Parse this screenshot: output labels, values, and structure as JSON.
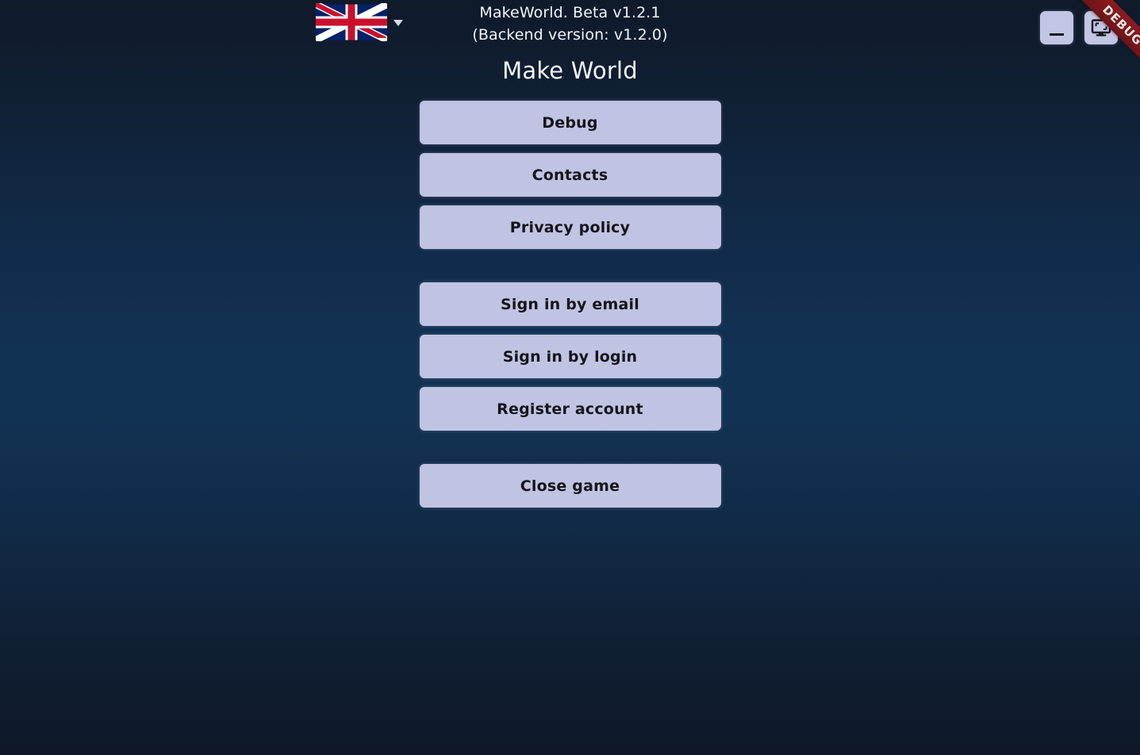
{
  "window": {
    "title_line1": "MakeWorld. Beta v1.2.1",
    "title_line2": "(Backend version: v1.2.0)",
    "debug_ribbon_label": "DEBUG",
    "minimize_label": "Minimize",
    "fullscreen_label": "Toggle fullscreen",
    "minimize_icon": "minimize-icon",
    "fullscreen_icon": "monitor-icon"
  },
  "language": {
    "selected": "English (United Kingdom)",
    "flag_icon": "union-jack-flag-icon",
    "caret_icon": "chevron-down-icon"
  },
  "menu": {
    "title": "Make World",
    "groups": [
      {
        "name": "info",
        "buttons": [
          {
            "label": "Debug"
          },
          {
            "label": "Contacts"
          },
          {
            "label": "Privacy policy"
          }
        ]
      },
      {
        "name": "account",
        "buttons": [
          {
            "label": "Sign in by email"
          },
          {
            "label": "Sign in by login"
          },
          {
            "label": "Register account"
          }
        ]
      },
      {
        "name": "exit",
        "buttons": [
          {
            "label": "Close game"
          }
        ]
      }
    ]
  },
  "colors": {
    "button_face": "#c0c3e2",
    "button_text": "#14141a",
    "background_top": "#0f1a2a",
    "background_mid": "#123254",
    "background_bottom": "#0e1828",
    "ribbon_red": "#8c1c20",
    "title_text": "#f4f6fb"
  }
}
